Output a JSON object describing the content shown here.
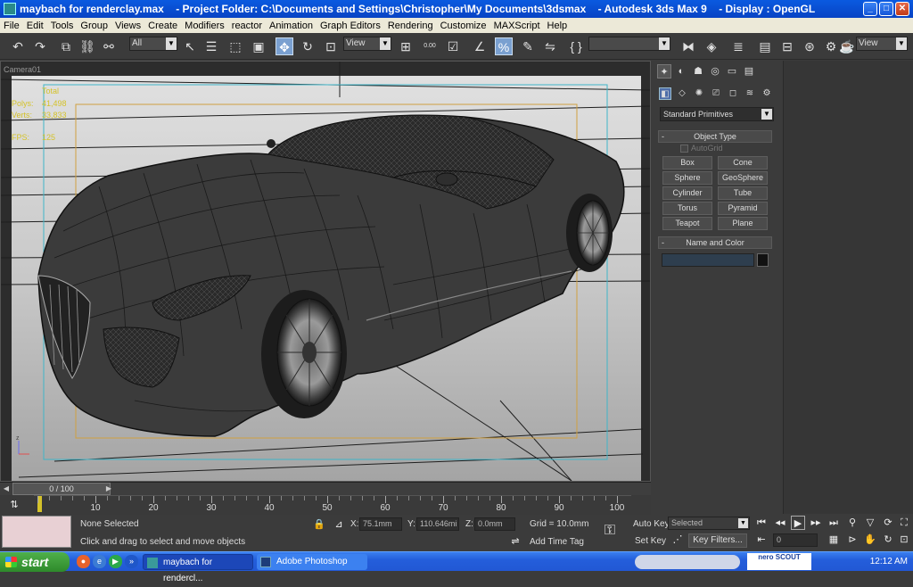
{
  "window": {
    "title": "maybach for renderclay.max    - Project Folder: C:\\Documents and Settings\\Christopher\\My Documents\\3dsmax    - Autodesk 3ds Max 9    - Display : OpenGL",
    "buttons": [
      "minimize",
      "maximize",
      "close"
    ]
  },
  "menubar": [
    "File",
    "Edit",
    "Tools",
    "Group",
    "Views",
    "Create",
    "Modifiers",
    "reactor",
    "Animation",
    "Graph Editors",
    "Rendering",
    "Customize",
    "MAXScript",
    "Help"
  ],
  "toolbar": {
    "selection_filter": "All",
    "ref_coord": "View",
    "snap_value": "0.00",
    "named_selection": "",
    "render_view": "View",
    "icons": [
      "undo-icon",
      "redo-icon",
      "link-icon",
      "unlink-icon",
      "bind-icon",
      "select-icon",
      "select-name-icon",
      "region-icon",
      "window-icon",
      "move-icon",
      "rotate-icon",
      "scale-icon",
      "pivot-icon",
      "snap-icon",
      "angle-snap-icon",
      "percent-snap-icon",
      "spinner-snap-icon",
      "edit-named-icon",
      "mirror-icon",
      "align-icon",
      "layer-icon",
      "curve-icon",
      "schematic-icon",
      "material-icon",
      "render-setup-icon",
      "render-icon",
      "quick-render-icon"
    ]
  },
  "viewport": {
    "label": "Camera01",
    "stats": {
      "total_label": "Total",
      "polys_label": "Polys:",
      "polys_value": "41,498",
      "verts_label": "Verts:",
      "verts_value": "33,833",
      "fps_label": "FPS:",
      "fps_value": "125"
    },
    "colors": {
      "background_top": "#d8d8d8",
      "background_bottom": "#a8a8a8",
      "safe_frame_outer": "#3fb5c8",
      "safe_frame_inner": "#d0a040",
      "car_body": "#3c3c3c",
      "wire": "#1a1a1a"
    }
  },
  "command_panel": {
    "tabs": [
      "create-tab-icon",
      "modify-tab-icon",
      "hierarchy-tab-icon",
      "motion-tab-icon",
      "display-tab-icon",
      "utilities-tab-icon"
    ],
    "subtabs": [
      "geometry-icon",
      "shapes-icon",
      "lights-icon",
      "cameras-icon",
      "helpers-icon",
      "spacewarps-icon",
      "systems-icon"
    ],
    "category": "Standard Primitives",
    "object_type": {
      "title": "Object Type",
      "autogrid": "AutoGrid",
      "buttons": [
        "Box",
        "Cone",
        "Sphere",
        "GeoSphere",
        "Cylinder",
        "Tube",
        "Torus",
        "Pyramid",
        "Teapot",
        "Plane"
      ]
    },
    "name_and_color": {
      "title": "Name and Color",
      "name": "",
      "color": "#111111"
    }
  },
  "timeline": {
    "slider_label": "0 / 100",
    "ticks": [
      "0",
      "10",
      "20",
      "30",
      "40",
      "50",
      "60",
      "70",
      "80",
      "90",
      "100"
    ],
    "current_frame": 0
  },
  "status": {
    "selection": "None Selected",
    "prompt": "Click and drag to select and move objects",
    "x_label": "X:",
    "x_value": "75.1mm",
    "y_label": "Y:",
    "y_value": "110.646mi",
    "z_label": "Z:",
    "z_value": "0.0mm",
    "grid": "Grid = 10.0mm",
    "add_time_tag": "Add Time Tag",
    "auto_key": "Auto Key",
    "set_key": "Set Key",
    "key_mode": "Selected",
    "key_filters": "Key Filters...",
    "frame_value": "0"
  },
  "taskbar": {
    "start": "start",
    "tasks": [
      {
        "label": "maybach for rendercl...",
        "active": true
      },
      {
        "label": "Adobe Photoshop",
        "active": false
      }
    ],
    "tray_logo": "nero SCOUT",
    "clock": "12:12 AM"
  }
}
